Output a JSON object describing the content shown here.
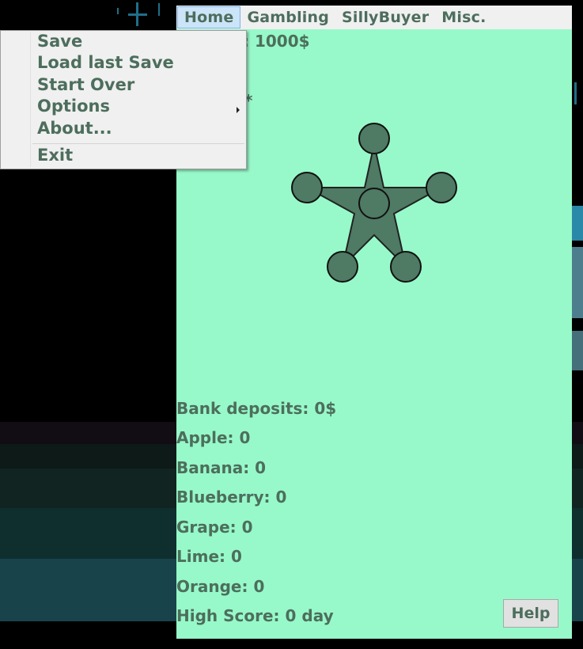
{
  "menubar": {
    "items": [
      {
        "label": "Home"
      },
      {
        "label": "Gambling"
      },
      {
        "label": "SillyBuyer"
      },
      {
        "label": "Misc."
      }
    ]
  },
  "home_menu": {
    "items": [
      {
        "label": "Save"
      },
      {
        "label": "Load last Save"
      },
      {
        "label": "Start Over"
      },
      {
        "label": "Options"
      },
      {
        "label": "About..."
      },
      {
        "label": "Exit"
      }
    ]
  },
  "game": {
    "money_partial": ": 1000$",
    "partial_line": "*",
    "bank_deposits": "Bank deposits: 0$",
    "fruits": [
      {
        "label": "Apple: 0"
      },
      {
        "label": "Banana: 0"
      },
      {
        "label": "Blueberry: 0"
      },
      {
        "label": "Grape: 0"
      },
      {
        "label": "Lime: 0"
      },
      {
        "label": "Orange: 0"
      }
    ],
    "high_score": "High Score: 0 day",
    "help_label": "Help"
  },
  "colors": {
    "game_background": "#97f9c9",
    "text": "#4d6e5d",
    "star_fill": "#4f7a64",
    "menu_highlight": "#cce4f7"
  },
  "icons": {
    "star": "sheriff-star-icon",
    "submenu": "submenu-arrow-icon"
  }
}
